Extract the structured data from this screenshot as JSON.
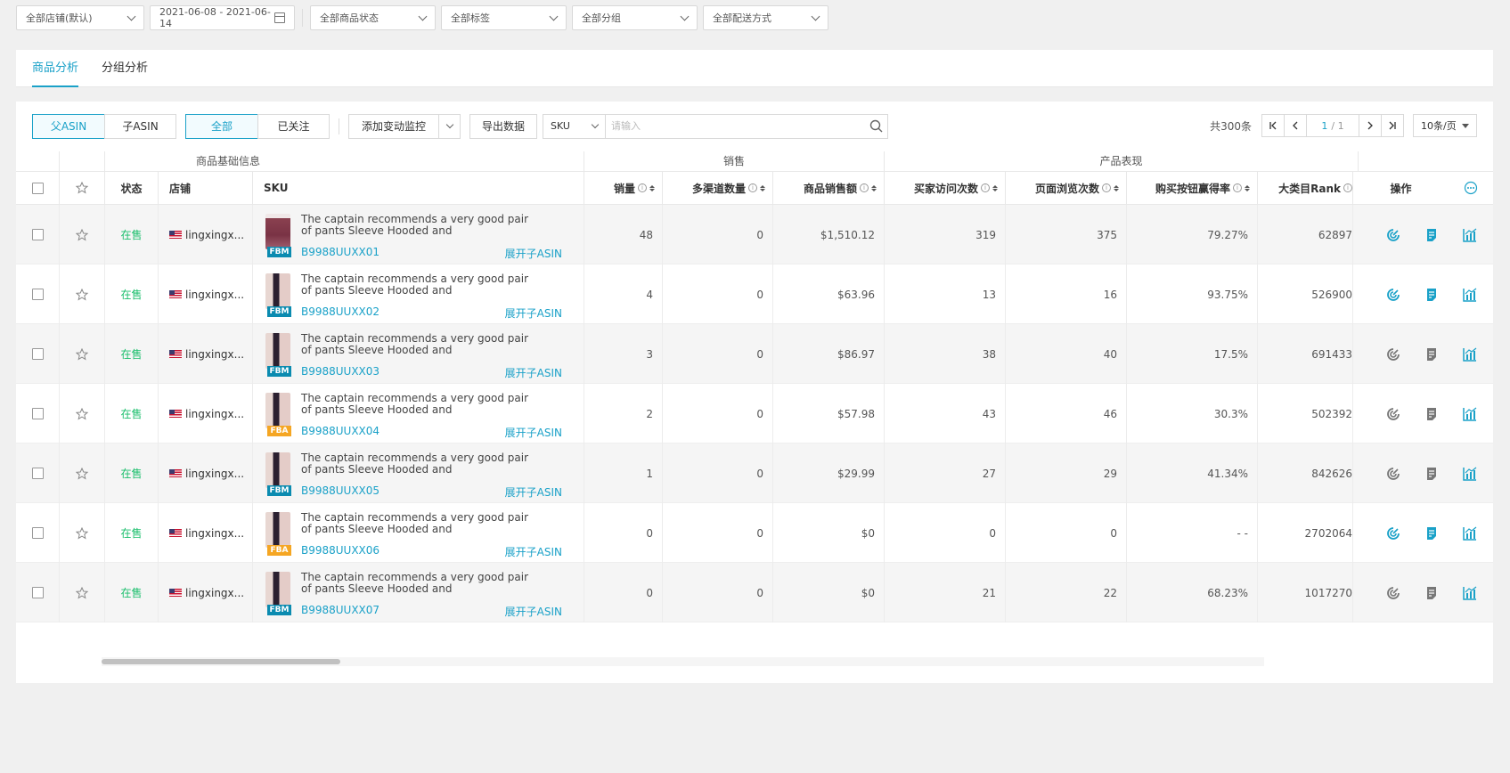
{
  "filters": {
    "shop": "全部店铺(默认)",
    "date_range": "2021-06-08 - 2021-06-14",
    "product_status": "全部商品状态",
    "tags": "全部标签",
    "groups": "全部分组",
    "delivery": "全部配送方式"
  },
  "tabs": [
    {
      "label": "商品分析",
      "active": true
    },
    {
      "label": "分组分析",
      "active": false
    }
  ],
  "toolbar": {
    "parent_asin": "父ASIN",
    "child_asin": "子ASIN",
    "all": "全部",
    "followed": "已关注",
    "add_monitor": "添加变动监控",
    "export": "导出数据",
    "search_type": "SKU",
    "search_placeholder": "请输入"
  },
  "pager": {
    "total": "共300条",
    "current": "1",
    "pages": "/ 1",
    "page_size": "10条/页"
  },
  "table": {
    "groups": {
      "basic": "商品基础信息",
      "sales": "销售",
      "performance": "产品表现"
    },
    "columns": {
      "status": "状态",
      "shop": "店铺",
      "sku": "SKU",
      "sales_qty": "销量",
      "multi_channel": "多渠道数量",
      "sales_amount": "商品销售额",
      "buyer_visits": "买家访问次数",
      "page_views": "页面浏览次数",
      "buybox_rate": "购买按钮赢得率",
      "category_rank": "大类目Rank",
      "ops": "操作"
    },
    "expand_label": "展开子ASIN",
    "rows": [
      {
        "status": "在售",
        "shop": "lingxingx...",
        "title": "The captain recommends a very good pair of pants Sleeve Hooded and",
        "asin": "B9988UUXX01",
        "ship": "FBM",
        "img": "t1",
        "sales_qty": "48",
        "multi_channel": "0",
        "sales_amount": "$1,510.12",
        "buyer_visits": "319",
        "page_views": "375",
        "buybox_rate": "79.27%",
        "category_rank": "62897",
        "ops_active": [
          true,
          true,
          true
        ]
      },
      {
        "status": "在售",
        "shop": "lingxingx...",
        "title": "The captain recommends a very good pair of pants Sleeve Hooded and",
        "asin": "B9988UUXX02",
        "ship": "FBM",
        "img": "t2",
        "sales_qty": "4",
        "multi_channel": "0",
        "sales_amount": "$63.96",
        "buyer_visits": "13",
        "page_views": "16",
        "buybox_rate": "93.75%",
        "category_rank": "526900",
        "ops_active": [
          true,
          true,
          true
        ]
      },
      {
        "status": "在售",
        "shop": "lingxingx...",
        "title": "The captain recommends a very good pair of pants Sleeve Hooded and",
        "asin": "B9988UUXX03",
        "ship": "FBM",
        "img": "t2",
        "sales_qty": "3",
        "multi_channel": "0",
        "sales_amount": "$86.97",
        "buyer_visits": "38",
        "page_views": "40",
        "buybox_rate": "17.5%",
        "category_rank": "691433",
        "ops_active": [
          false,
          false,
          true
        ]
      },
      {
        "status": "在售",
        "shop": "lingxingx...",
        "title": "The captain recommends a very good pair of pants Sleeve Hooded and",
        "asin": "B9988UUXX04",
        "ship": "FBA",
        "img": "t2",
        "sales_qty": "2",
        "multi_channel": "0",
        "sales_amount": "$57.98",
        "buyer_visits": "43",
        "page_views": "46",
        "buybox_rate": "30.3%",
        "category_rank": "502392",
        "ops_active": [
          false,
          false,
          true
        ]
      },
      {
        "status": "在售",
        "shop": "lingxingx...",
        "title": "The captain recommends a very good pair of pants Sleeve Hooded and",
        "asin": "B9988UUXX05",
        "ship": "FBM",
        "img": "t2",
        "sales_qty": "1",
        "multi_channel": "0",
        "sales_amount": "$29.99",
        "buyer_visits": "27",
        "page_views": "29",
        "buybox_rate": "41.34%",
        "category_rank": "842626",
        "ops_active": [
          false,
          false,
          true
        ]
      },
      {
        "status": "在售",
        "shop": "lingxingx...",
        "title": "The captain recommends a very good pair of pants Sleeve Hooded and",
        "asin": "B9988UUXX06",
        "ship": "FBA",
        "img": "t2",
        "sales_qty": "0",
        "multi_channel": "0",
        "sales_amount": "$0",
        "buyer_visits": "0",
        "page_views": "0",
        "buybox_rate": "- -",
        "category_rank": "2702064",
        "ops_active": [
          true,
          true,
          true
        ]
      },
      {
        "status": "在售",
        "shop": "lingxingx...",
        "title": "The captain recommends a very good pair of pants Sleeve Hooded and",
        "asin": "B9988UUXX07",
        "ship": "FBM",
        "img": "t2",
        "sales_qty": "0",
        "multi_channel": "0",
        "sales_amount": "$0",
        "buyer_visits": "21",
        "page_views": "22",
        "buybox_rate": "68.23%",
        "category_rank": "1017270",
        "ops_active": [
          false,
          false,
          true
        ]
      }
    ]
  },
  "colors": {
    "accent": "#1aa1c8",
    "status_green": "#19be6b",
    "fbm": "#0b8bb0",
    "fba": "#f5a623"
  }
}
